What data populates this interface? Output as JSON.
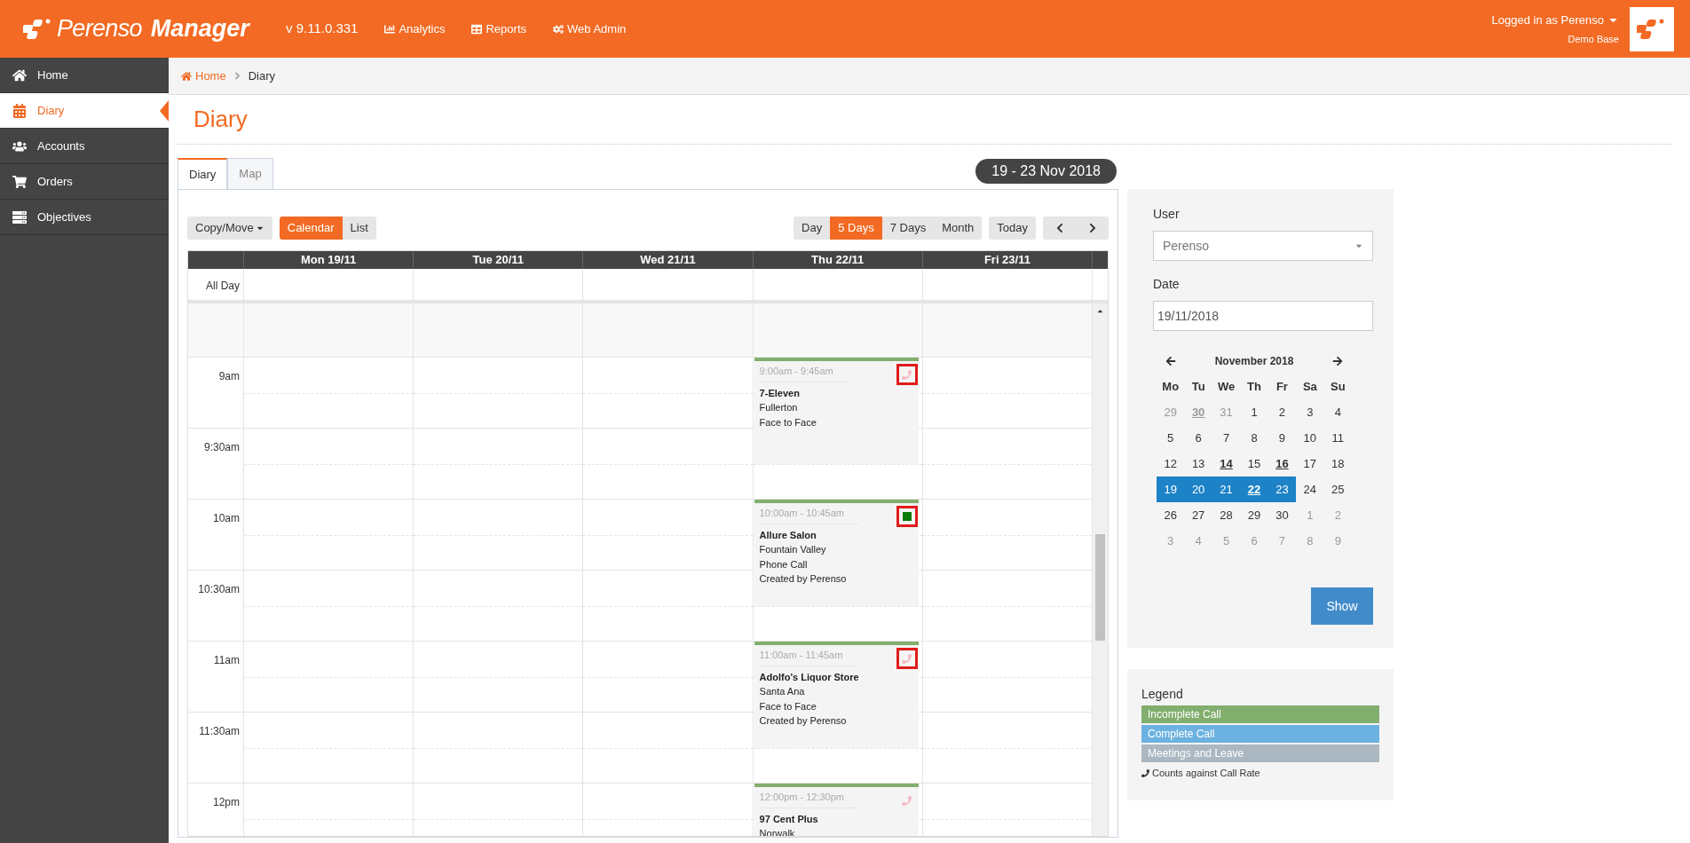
{
  "header": {
    "logo": {
      "brand": "Perenso",
      "product": "Manager"
    },
    "version": "v 9.11.0.331",
    "nav": [
      {
        "kind": "analytics",
        "label": "Analytics"
      },
      {
        "kind": "reports",
        "label": "Reports"
      },
      {
        "kind": "admin",
        "label": "Web Admin"
      }
    ],
    "user": "Logged in as Perenso",
    "base": "Demo Base"
  },
  "sidebar": {
    "items": [
      {
        "kind": "home",
        "label": "Home",
        "selected": false
      },
      {
        "kind": "diary",
        "label": "Diary",
        "selected": true
      },
      {
        "kind": "accounts",
        "label": "Accounts",
        "selected": false
      },
      {
        "kind": "orders",
        "label": "Orders",
        "selected": false
      },
      {
        "kind": "objectives",
        "label": "Objectives",
        "selected": false
      }
    ]
  },
  "breadcrumb": {
    "home": "Home",
    "current": "Diary"
  },
  "page_title": "Diary",
  "tabs": [
    {
      "label": "Diary",
      "selected": true
    },
    {
      "label": "Map",
      "selected": false
    }
  ],
  "range": "19 - 23 Nov 2018",
  "toolbar": {
    "copy_move": "Copy/Move",
    "modes": [
      {
        "label": "Calendar",
        "selected": true
      },
      {
        "label": "List",
        "selected": false
      }
    ],
    "views": [
      {
        "label": "Day",
        "selected": false
      },
      {
        "label": "5 Days",
        "selected": true
      },
      {
        "label": "7 Days",
        "selected": false
      },
      {
        "label": "Month",
        "selected": false
      }
    ],
    "today": "Today"
  },
  "calendar": {
    "days": [
      "Mon 19/11",
      "Tue 20/11",
      "Wed 21/11",
      "Thu 22/11",
      "Fri 23/11"
    ],
    "all_day": "All Day",
    "slots": [
      "9am",
      "9:30am",
      "10am",
      "10:30am",
      "11am",
      "11:30am",
      "12pm"
    ],
    "events": [
      {
        "time": "9:00am - 9:45am",
        "name": "7-Eleven",
        "lines": [
          "Fullerton",
          "Face to Face"
        ],
        "kind": "phone",
        "highlighted": true
      },
      {
        "time": "10:00am - 10:45am",
        "name": "Allure Salon",
        "lines": [
          "Fountain Valley",
          "Phone Call",
          "Created by Perenso"
        ],
        "kind": "complete",
        "highlighted": true
      },
      {
        "time": "11:00am - 11:45am",
        "name": "Adolfo's Liquor Store",
        "lines": [
          "Santa Ana",
          "Face to Face",
          "Created by Perenso"
        ],
        "kind": "phone",
        "highlighted": true
      },
      {
        "time": "12:00pm - 12:30pm",
        "name": "97 Cent Plus",
        "lines": [
          "Norwalk"
        ],
        "kind": "phone",
        "highlighted": false
      }
    ]
  },
  "filter": {
    "user_label": "User",
    "user_value": "Perenso",
    "date_label": "Date",
    "date_value": "19/11/2018",
    "month": "November 2018",
    "weekdays": [
      "Mo",
      "Tu",
      "We",
      "Th",
      "Fr",
      "Sa",
      "Su"
    ],
    "weeks": [
      [
        {
          "d": "29",
          "muted": true,
          "marked": false,
          "selected": false
        },
        {
          "d": "30",
          "muted": true,
          "marked": true,
          "selected": false
        },
        {
          "d": "31",
          "muted": true,
          "marked": false,
          "selected": false
        },
        {
          "d": "1",
          "muted": false,
          "marked": false,
          "selected": false
        },
        {
          "d": "2",
          "muted": false,
          "marked": false,
          "selected": false
        },
        {
          "d": "3",
          "muted": false,
          "marked": false,
          "selected": false
        },
        {
          "d": "4",
          "muted": false,
          "marked": false,
          "selected": false
        }
      ],
      [
        {
          "d": "5",
          "muted": false,
          "marked": false,
          "selected": false
        },
        {
          "d": "6",
          "muted": false,
          "marked": false,
          "selected": false
        },
        {
          "d": "7",
          "muted": false,
          "marked": false,
          "selected": false
        },
        {
          "d": "8",
          "muted": false,
          "marked": false,
          "selected": false
        },
        {
          "d": "9",
          "muted": false,
          "marked": false,
          "selected": false
        },
        {
          "d": "10",
          "muted": false,
          "marked": false,
          "selected": false
        },
        {
          "d": "11",
          "muted": false,
          "marked": false,
          "selected": false
        }
      ],
      [
        {
          "d": "12",
          "muted": false,
          "marked": false,
          "selected": false
        },
        {
          "d": "13",
          "muted": false,
          "marked": false,
          "selected": false
        },
        {
          "d": "14",
          "muted": false,
          "marked": true,
          "selected": false
        },
        {
          "d": "15",
          "muted": false,
          "marked": false,
          "selected": false
        },
        {
          "d": "16",
          "muted": false,
          "marked": true,
          "selected": false
        },
        {
          "d": "17",
          "muted": false,
          "marked": false,
          "selected": false
        },
        {
          "d": "18",
          "muted": false,
          "marked": false,
          "selected": false
        }
      ],
      [
        {
          "d": "19",
          "muted": false,
          "marked": false,
          "selected": true
        },
        {
          "d": "20",
          "muted": false,
          "marked": false,
          "selected": true
        },
        {
          "d": "21",
          "muted": false,
          "marked": false,
          "selected": true
        },
        {
          "d": "22",
          "muted": false,
          "marked": true,
          "selected": true
        },
        {
          "d": "23",
          "muted": false,
          "marked": false,
          "selected": true
        },
        {
          "d": "24",
          "muted": false,
          "marked": false,
          "selected": false
        },
        {
          "d": "25",
          "muted": false,
          "marked": false,
          "selected": false
        }
      ],
      [
        {
          "d": "26",
          "muted": false,
          "marked": false,
          "selected": false
        },
        {
          "d": "27",
          "muted": false,
          "marked": false,
          "selected": false
        },
        {
          "d": "28",
          "muted": false,
          "marked": false,
          "selected": false
        },
        {
          "d": "29",
          "muted": false,
          "marked": false,
          "selected": false
        },
        {
          "d": "30",
          "muted": false,
          "marked": false,
          "selected": false
        },
        {
          "d": "1",
          "muted": true,
          "marked": false,
          "selected": false
        },
        {
          "d": "2",
          "muted": true,
          "marked": false,
          "selected": false
        }
      ],
      [
        {
          "d": "3",
          "muted": true,
          "marked": false,
          "selected": false
        },
        {
          "d": "4",
          "muted": true,
          "marked": false,
          "selected": false
        },
        {
          "d": "5",
          "muted": true,
          "marked": false,
          "selected": false
        },
        {
          "d": "6",
          "muted": true,
          "marked": false,
          "selected": false
        },
        {
          "d": "7",
          "muted": true,
          "marked": false,
          "selected": false
        },
        {
          "d": "8",
          "muted": true,
          "marked": false,
          "selected": false
        },
        {
          "d": "9",
          "muted": true,
          "marked": false,
          "selected": false
        }
      ]
    ],
    "show": "Show"
  },
  "legend": {
    "title": "Legend",
    "items": [
      {
        "label": "Incomplete Call",
        "color": "#82ae6e"
      },
      {
        "label": "Complete Call",
        "color": "#6cb2e0"
      },
      {
        "label": "Meetings and Leave",
        "color": "#abb8c1"
      }
    ],
    "note": "Counts against Call Rate"
  }
}
